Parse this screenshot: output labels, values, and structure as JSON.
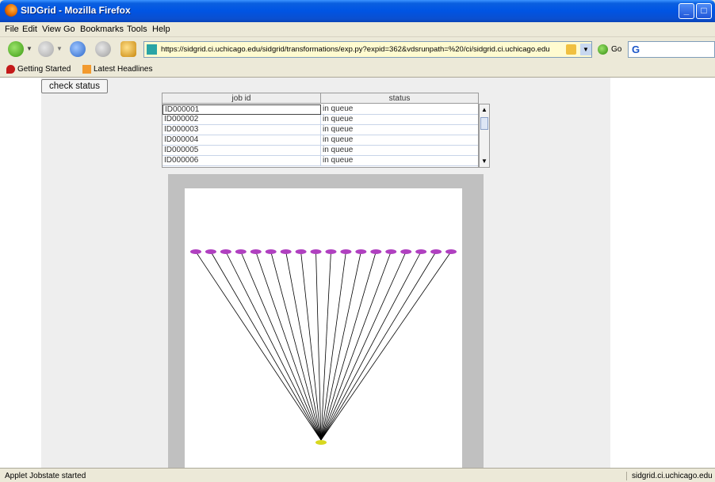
{
  "window": {
    "title": "SIDGrid - Mozilla Firefox"
  },
  "menu": [
    "File",
    "Edit",
    "View",
    "Go",
    "Bookmarks",
    "Tools",
    "Help"
  ],
  "nav": {
    "url": "https://sidgrid.ci.uchicago.edu/sidgrid/transformations/exp.py?expid=362&vdsrunpath=%20/ci/sidgrid.ci.uchicago.edu",
    "go_label": "Go",
    "search_glyph": "G"
  },
  "bookmarks": [
    "Getting Started",
    "Latest Headlines"
  ],
  "applet": {
    "check_button": "check status",
    "table": {
      "columns": [
        "job id",
        "status"
      ],
      "rows": [
        {
          "id": "ID000001",
          "status": "in queue"
        },
        {
          "id": "ID000002",
          "status": "in queue"
        },
        {
          "id": "ID000003",
          "status": "in queue"
        },
        {
          "id": "ID000004",
          "status": "in queue"
        },
        {
          "id": "ID000005",
          "status": "in queue"
        },
        {
          "id": "ID000006",
          "status": "in queue"
        }
      ]
    },
    "graph": {
      "top_node_count": 18,
      "node_color": "#b040c0",
      "edge_color": "#000000",
      "sink_color": "#d8d820"
    }
  },
  "status": {
    "text": "Applet Jobstate started",
    "host": "sidgrid.ci.uchicago.edu"
  },
  "colors": {
    "titlebar": "#0054e3",
    "chrome": "#ece9d8",
    "applet_bg": "#eeeeee",
    "graph_frame": "#c0c0c0"
  }
}
